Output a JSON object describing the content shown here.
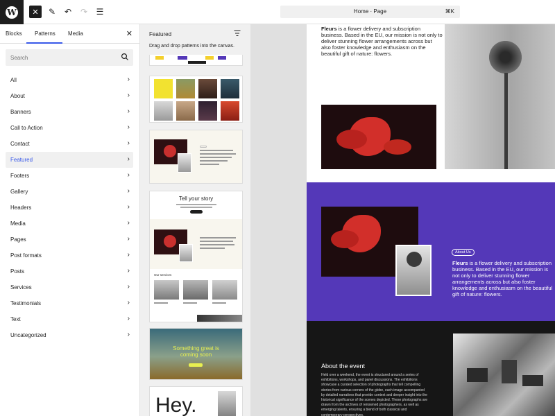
{
  "toolbar": {
    "logo_letter": "W",
    "close_icon": "✕",
    "pen_icon": "✎",
    "undo_icon": "↶",
    "redo_icon": "↷",
    "list_icon": "☰",
    "command": {
      "title": "Home · Page",
      "shortcut": "⌘K"
    }
  },
  "inserter": {
    "tabs": [
      "Blocks",
      "Patterns",
      "Media"
    ],
    "active_tab": "Patterns",
    "close_icon": "✕",
    "search_placeholder": "Search",
    "categories": [
      "All",
      "About",
      "Banners",
      "Call to Action",
      "Contact",
      "Featured",
      "Footers",
      "Gallery",
      "Headers",
      "Media",
      "Pages",
      "Post formats",
      "Posts",
      "Services",
      "Testimonials",
      "Text",
      "Uncategorized"
    ],
    "active_category": "Featured",
    "chevron": "›"
  },
  "patterns": {
    "title": "Featured",
    "description": "Drag and drop patterns into the canvas.",
    "card_story_title": "Tell your story",
    "card_story_services": "Our services",
    "card_banner_text": "Something great is coming soon",
    "card_hey_text": "Hey."
  },
  "canvas": {
    "intro_brand": "Fleurs",
    "intro_text": " is a flower delivery and subscription business. Based in the EU, our mission is not only to deliver stunning flower arrangements across but also foster knowledge and enthusiasm on the beautiful gift of nature: flowers.",
    "about_badge": "About Us",
    "about_brand": "Fleurs",
    "about_text": " is a flower delivery and subscription business. Based in the EU, our mission is not only to deliver stunning flower arrangements across but also foster knowledge and enthusiasm on the beautiful gift of nature: flowers.",
    "event_title": "About the event",
    "event_text": "Held over a weekend, the event is structured around a series of exhibitions, workshops, and panel discussions. The exhibitions showcase a curated selection of photographs that tell compelling stories from various corners of the globe, each image accompanied by detailed narratives that provide context and deeper insight into the historical significance of the scenes depicted. These photographs are drawn from the archives of renowned photographers, as well as emerging talents, ensuring a blend of both classical and contemporary perspectives."
  },
  "colors": {
    "accent": "#3858e9",
    "purple_section": "#5438b8",
    "dark_section": "#161616"
  }
}
